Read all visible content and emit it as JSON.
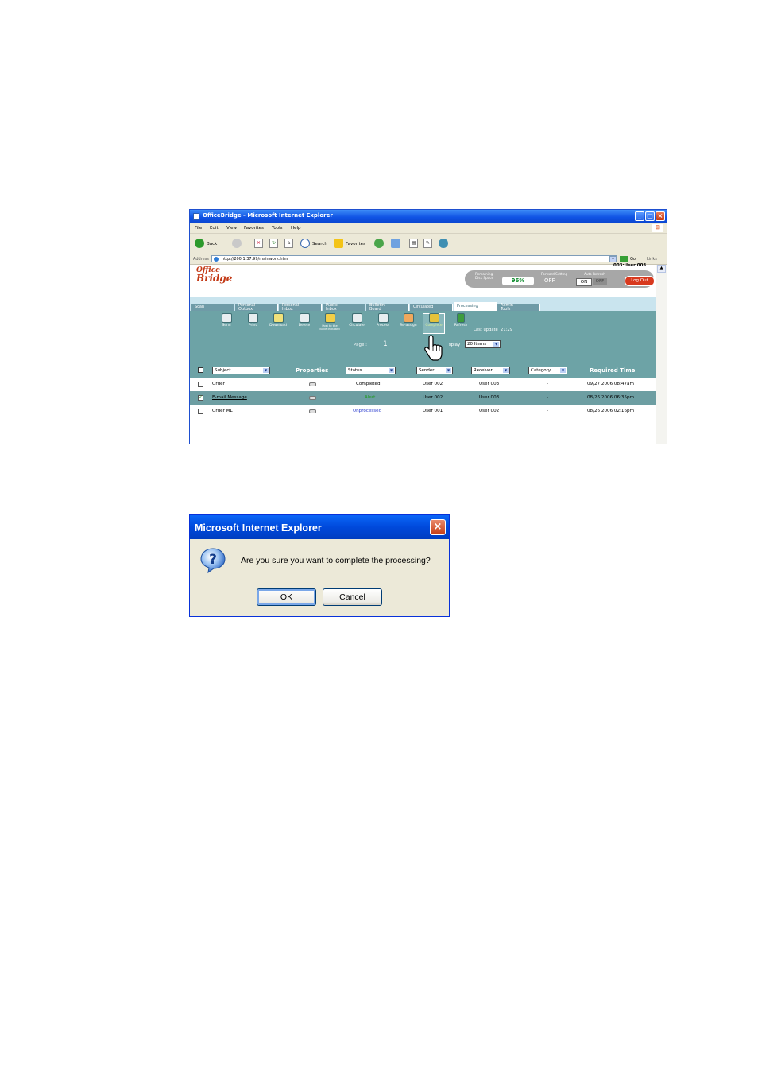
{
  "browser": {
    "title": "OfficeBridge - Microsoft Internet Explorer",
    "menu": [
      "File",
      "Edit",
      "View",
      "Favorites",
      "Tools",
      "Help"
    ],
    "toolbar": {
      "back": "Back",
      "search": "Search",
      "favorites": "Favorites"
    },
    "address_label": "Address",
    "address": "http://200.1.37.99/mainwork.htm",
    "go": "Go",
    "links": "Links"
  },
  "app": {
    "logo_top": "Office",
    "logo_bottom": "Bridge",
    "user": "003:User 003",
    "status": {
      "disk_label_1": "Remaining",
      "disk_label_2": "Disk Space",
      "disk_value": "96%",
      "forward_label": "Forward Setting",
      "forward_value": "OFF",
      "autorefresh_label": "Auto Refresh",
      "on": "ON",
      "off": "OFF",
      "logout": "Log Out"
    },
    "tabs": [
      {
        "l1": "Scan",
        "l2": ""
      },
      {
        "l1": "Personal",
        "l2": "Outbox"
      },
      {
        "l1": "Personal",
        "l2": "Inbox"
      },
      {
        "l1": "Public",
        "l2": "Inbox"
      },
      {
        "l1": "Bulletin",
        "l2": "Board"
      },
      {
        "l1": "Circulated",
        "l2": ""
      },
      {
        "l1": "Processing",
        "l2": ""
      },
      {
        "l1": "Admin",
        "l2": "Tools"
      }
    ],
    "tools": [
      "Send",
      "Print",
      "Download",
      "Delete",
      "Post to the Bulletin Board",
      "Circulate",
      "Process",
      "Re-assign",
      "Complete",
      "Refresh"
    ],
    "last_update_label": "Last update",
    "last_update": "21:29",
    "page_label": "Page :",
    "page": "1",
    "display_label": "Display",
    "display_value": "20 Items",
    "columns": {
      "subject": "Subject",
      "properties": "Properties",
      "status": "Status",
      "sender": "Sender",
      "receiver": "Receiver",
      "category": "Category",
      "required_time": "Required Time"
    },
    "rows": [
      {
        "subject": "Order",
        "status": "Completed",
        "status_color": "#000000",
        "sender": "User 002",
        "receiver": "User 003",
        "category": "-",
        "time": "09/27 2006 08:47am",
        "checked": false
      },
      {
        "subject": "E-mail Message",
        "status": "Alert",
        "status_color": "#1f9a1f",
        "sender": "User 002",
        "receiver": "User 003",
        "category": "-",
        "time": "08/26 2006 06:35pm",
        "checked": true
      },
      {
        "subject": "Order ML",
        "status": "Unprocessed",
        "status_color": "#2b3ccf",
        "sender": "User 001",
        "receiver": "User 002",
        "category": "-",
        "time": "08/26 2006 02:16pm",
        "checked": false
      }
    ]
  },
  "dialog": {
    "title": "Microsoft Internet Explorer",
    "message": "Are you sure you want to complete the processing?",
    "ok": "OK",
    "cancel": "Cancel"
  },
  "colors": {
    "panel": "#6da3a6",
    "xp_title": "#0a55e6",
    "logo": "#c33a17"
  }
}
